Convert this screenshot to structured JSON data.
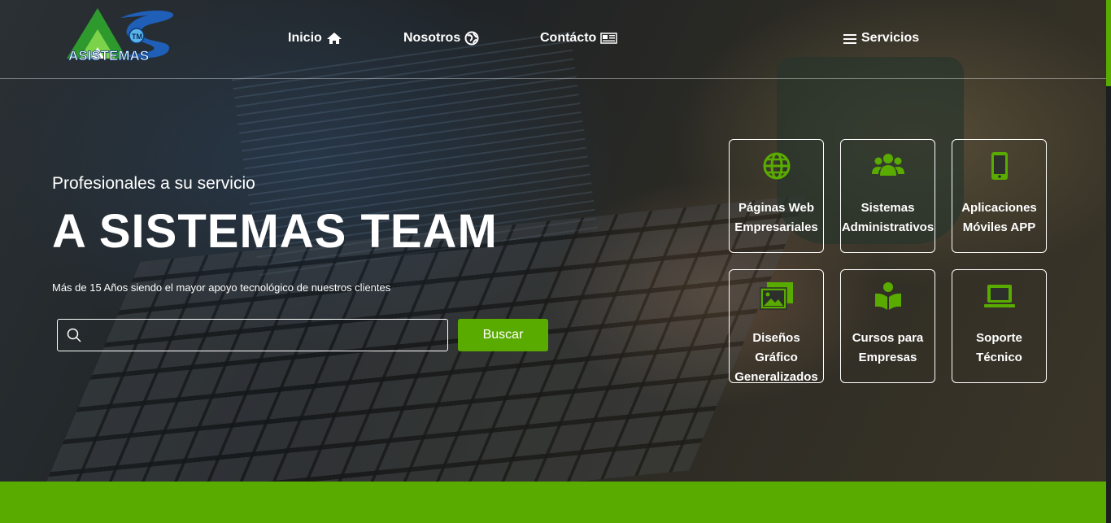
{
  "brand": {
    "logo_text": "ASISTEMAS",
    "logo_mark": "TM",
    "colors": {
      "accent": "#5aab00",
      "logo_blue": "#1f5fb8"
    }
  },
  "nav": {
    "inicio": {
      "label": "Inicio",
      "icon": "home-icon"
    },
    "nosotros": {
      "label": "Nosotros",
      "icon": "globe-icon"
    },
    "contacto": {
      "label": "Contácto",
      "icon": "contact-card-icon"
    },
    "servicios": {
      "label": "Servicios",
      "icon": "menu-icon"
    }
  },
  "hero": {
    "subtitle": "Profesionales a su servicio",
    "title": "A SISTEMAS TEAM",
    "description": "Más de 15 Años siendo el mayor apoyo tecnológico de nuestros clientes",
    "search": {
      "value": "",
      "placeholder": "",
      "icon": "search-icon"
    },
    "search_button": "Buscar"
  },
  "services": [
    {
      "line1": "Páginas Web",
      "line2": "Empresariales",
      "icon": "globe-icon"
    },
    {
      "line1": "Sistemas",
      "line2": "Administrativos",
      "icon": "users-icon"
    },
    {
      "line1": "Aplicaciones",
      "line2": "Móviles APP",
      "icon": "mobile-phone-icon"
    },
    {
      "line1": "Diseños Gráfico",
      "line2": "Generalizados",
      "icon": "images-icon"
    },
    {
      "line1": "Cursos para",
      "line2": "Empresas",
      "icon": "reader-book-icon"
    },
    {
      "line1": "Soporte Técnico",
      "line2": "",
      "icon": "laptop-icon"
    }
  ]
}
